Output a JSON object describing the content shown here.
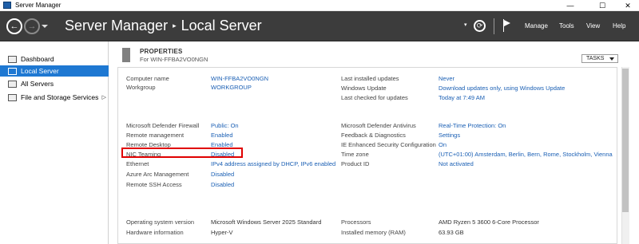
{
  "window": {
    "title": "Server Manager",
    "controls": {
      "minimize": "—",
      "maximize": "☐",
      "close": "✕"
    }
  },
  "header": {
    "breadcrumb_root": "Server Manager",
    "breadcrumb_separator": "▸",
    "breadcrumb_current": "Local Server",
    "menus": {
      "manage": "Manage",
      "tools": "Tools",
      "view": "View",
      "help": "Help"
    }
  },
  "sidebar": {
    "items": [
      {
        "label": "Dashboard",
        "icon": "dashboard-icon"
      },
      {
        "label": "Local Server",
        "icon": "server-icon",
        "active": true
      },
      {
        "label": "All Servers",
        "icon": "servers-icon"
      },
      {
        "label": "File and Storage Services",
        "icon": "storage-icon",
        "expand": "▷"
      }
    ]
  },
  "properties": {
    "title": "PROPERTIES",
    "subtitle": "For WIN-FFBA2VO0NGN",
    "tasks_label": "TASKS",
    "left": {
      "group1": [
        {
          "label": "Computer name",
          "value": "WIN-FFBA2VO0NGN"
        },
        {
          "label": "Workgroup",
          "value": "WORKGROUP"
        }
      ],
      "group2": [
        {
          "label": "Microsoft Defender Firewall",
          "value": "Public: On"
        },
        {
          "label": "Remote management",
          "value": "Enabled"
        },
        {
          "label": "Remote Desktop",
          "value": "Enabled"
        },
        {
          "label": "NIC Teaming",
          "value": "Disabled"
        },
        {
          "label": "Ethernet",
          "value": "IPv4 address assigned by DHCP, IPv6 enabled"
        },
        {
          "label": "Azure Arc Management",
          "value": "Disabled"
        },
        {
          "label": "Remote SSH Access",
          "value": "Disabled"
        }
      ],
      "group3": [
        {
          "label": "Operating system version",
          "value": "Microsoft Windows Server 2025 Standard"
        },
        {
          "label": "Hardware information",
          "value": "Hyper-V"
        }
      ]
    },
    "right": {
      "group1": [
        {
          "label": "Last installed updates",
          "value": "Never"
        },
        {
          "label": "Windows Update",
          "value": "Download updates only, using Windows Update"
        },
        {
          "label": "Last checked for updates",
          "value": "Today at 7:49 AM"
        }
      ],
      "group2": [
        {
          "label": "Microsoft Defender Antivirus",
          "value": "Real-Time Protection: On"
        },
        {
          "label": "Feedback & Diagnostics",
          "value": "Settings"
        },
        {
          "label": "IE Enhanced Security Configuration",
          "value": "On"
        },
        {
          "label": "Time zone",
          "value": "(UTC+01:00) Amsterdam, Berlin, Bern, Rome, Stockholm, Vienna"
        },
        {
          "label": "Product ID",
          "value": "Not activated"
        }
      ],
      "group3": [
        {
          "label": "Processors",
          "value": "AMD Ryzen 5 3600 6-Core Processor"
        },
        {
          "label": "Installed memory (RAM)",
          "value": "63.93 GB"
        }
      ]
    }
  },
  "colors": {
    "header_bg": "#3c3c3c",
    "active_nav": "#1e78d2",
    "link": "#1a5fb4",
    "highlight": "#e00000"
  }
}
